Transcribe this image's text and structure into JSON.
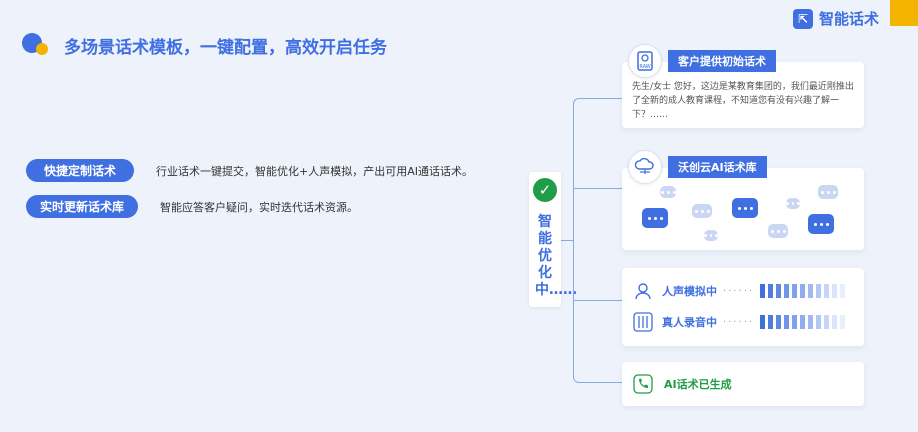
{
  "brand": {
    "name": "智能话术",
    "icon": "brand-logo-icon"
  },
  "header": {
    "title": "多场景话术模板，一键配置，高效开启任务"
  },
  "features": [
    {
      "label": "快捷定制话术",
      "desc": "行业话术一键提交，智能优化+人声模拟，产出可用AI通话话术。"
    },
    {
      "label": "实时更新话术库",
      "desc": "智能应答客户疑问，实时迭代话术资源。"
    }
  ],
  "center_badge": {
    "text": "智能优化中……",
    "icon": "check-circle-icon"
  },
  "cards": {
    "initial": {
      "tag": "客户提供初始话术",
      "icon": "raw-file-icon",
      "message": "先生/女士 您好，这边是某教育集团的，我们最近刚推出了全新的成人教育课程，不知道您有没有兴趣了解一下？……"
    },
    "library": {
      "tag": "沃创云AI话术库",
      "icon": "cloud-network-icon"
    },
    "process": {
      "voice": {
        "label": "人声模拟中",
        "dots": "······",
        "icon": "person-voice-icon"
      },
      "record": {
        "label": "真人录音中",
        "dots": "······",
        "icon": "equalizer-icon"
      }
    },
    "done": {
      "label": "AI话术已生成",
      "icon": "phone-icon"
    }
  },
  "colors": {
    "accent": "#3f6fe0",
    "yellow": "#f5b400",
    "green": "#1f9d4a",
    "background": "#eef3fb"
  }
}
